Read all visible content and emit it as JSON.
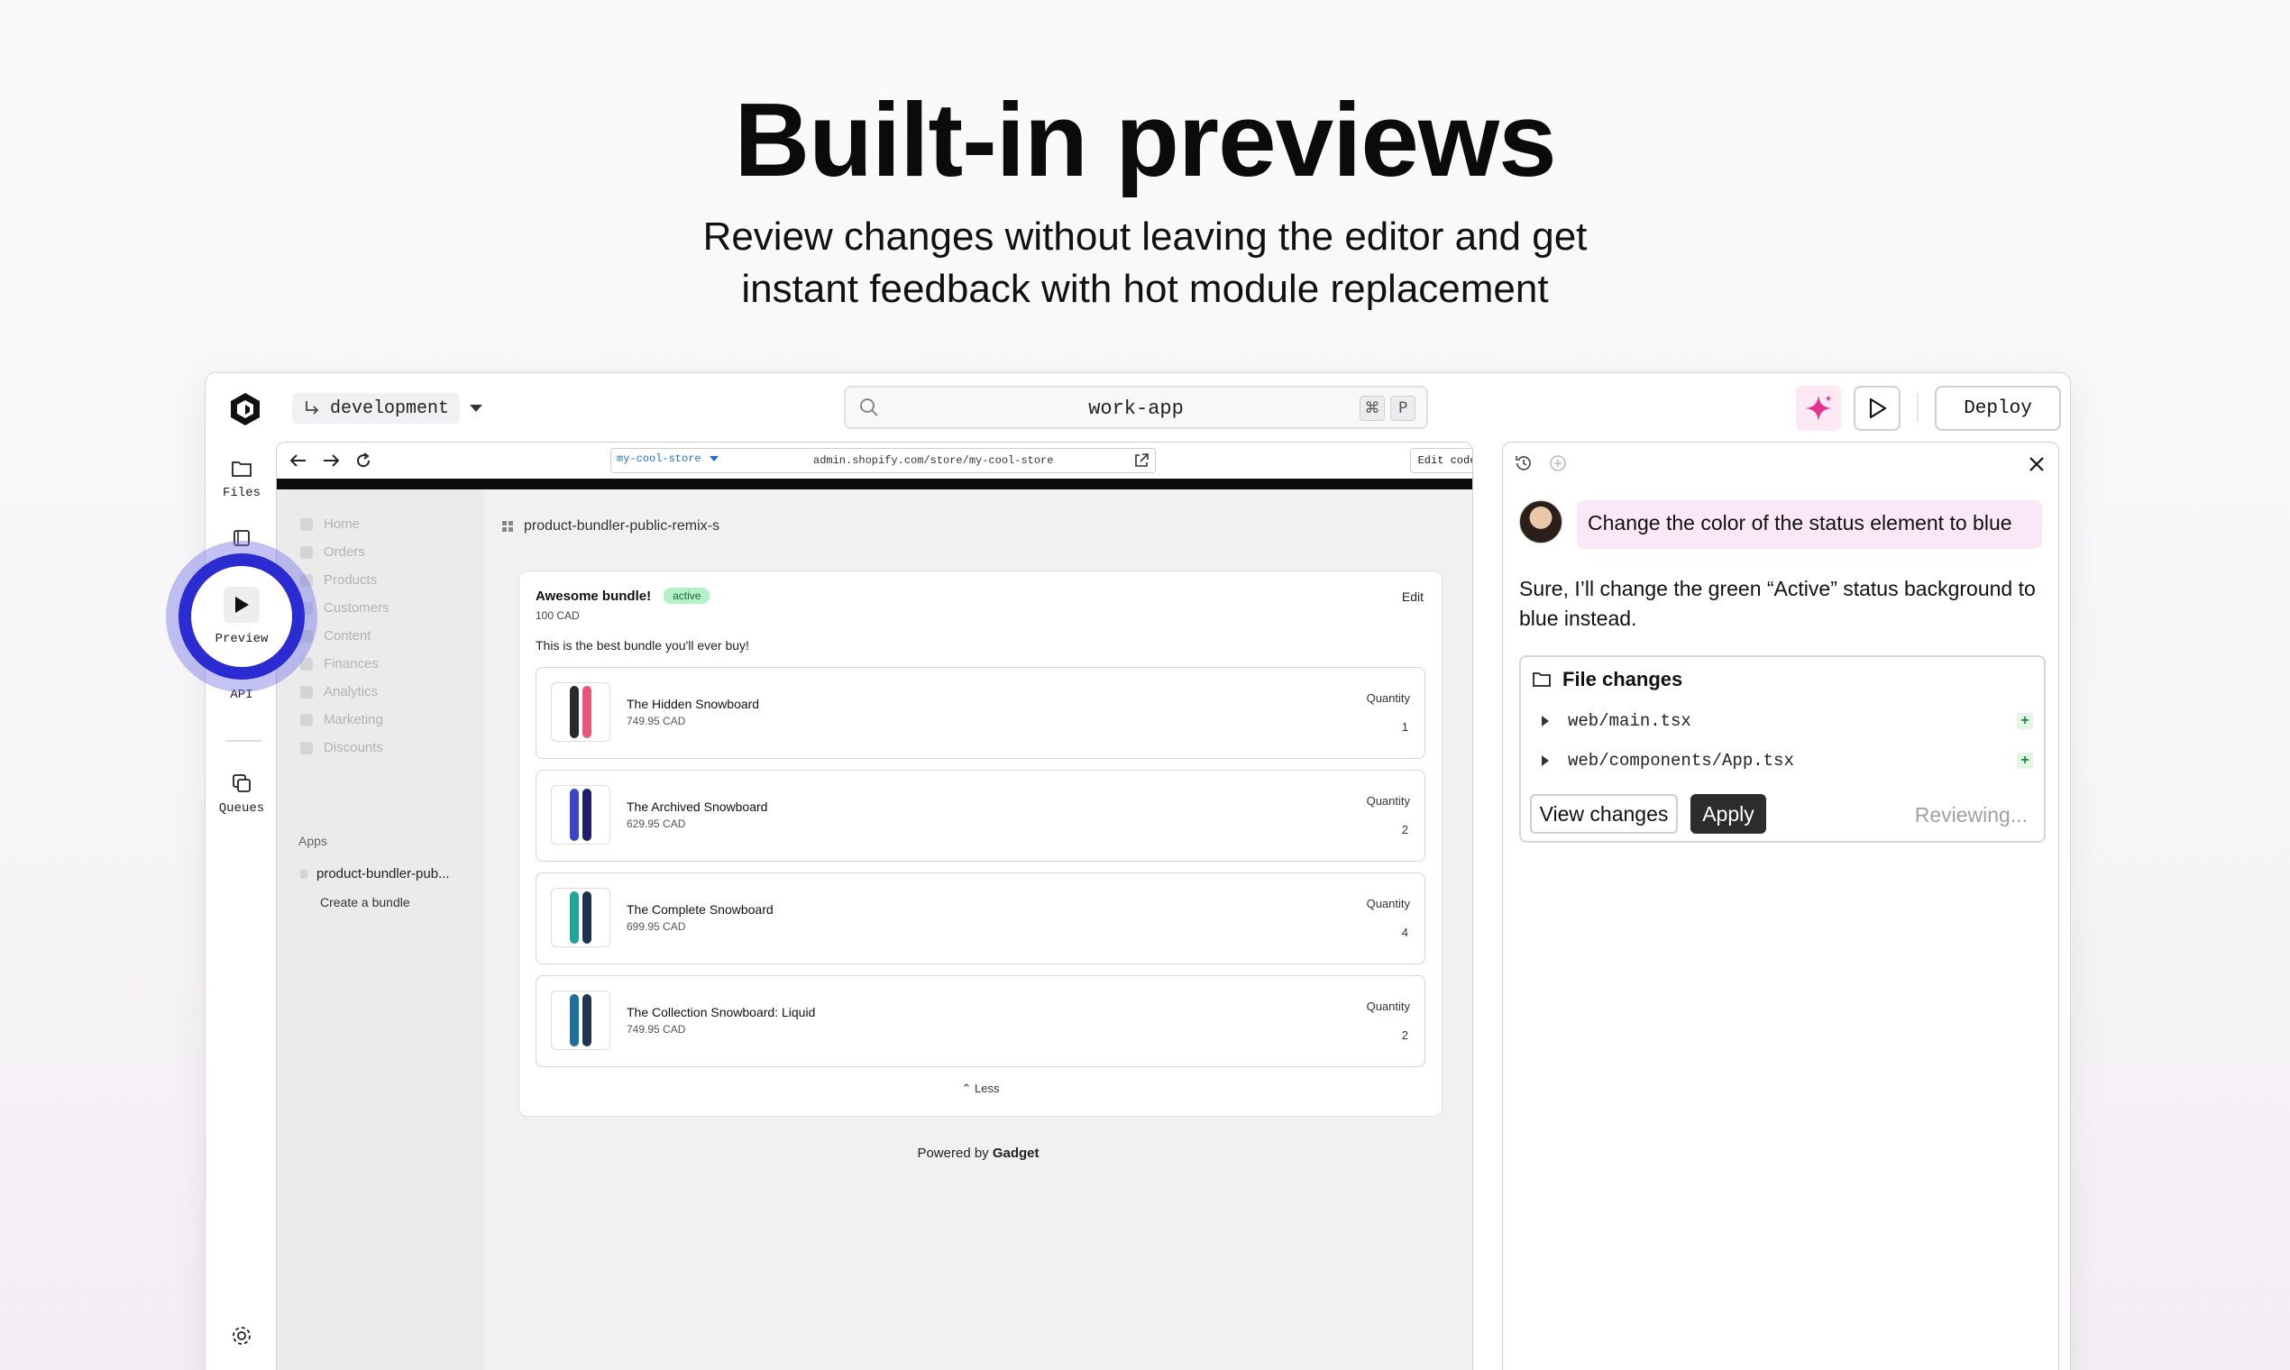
{
  "hero": {
    "title": "Built-in previews",
    "subtitle_line1": "Review changes without leaving the editor and get",
    "subtitle_line2": "instant feedback with hot module replacement"
  },
  "topbar": {
    "branch": "development",
    "search_text": "work-app",
    "shortcut_mod": "⌘",
    "shortcut_key": "P",
    "deploy_label": "Deploy"
  },
  "rail": {
    "files": "Files",
    "preview": "Preview",
    "api": "API",
    "queues": "Queues"
  },
  "browser": {
    "store": "my-cool-store",
    "url": "admin.shopify.com/store/my-cool-store",
    "edit_code": "Edit code"
  },
  "shop_nav": [
    "Home",
    "Orders",
    "Products",
    "Customers",
    "Content",
    "Finances",
    "Analytics",
    "Marketing",
    "Discounts"
  ],
  "apps": {
    "heading": "Apps",
    "item": "product-bundler-pub...",
    "sub": "Create a bundle"
  },
  "breadcrumb": "product-bundler-public-remix-s",
  "bundle": {
    "title": "Awesome bundle!",
    "status": "active",
    "price": "100 CAD",
    "edit": "Edit",
    "description": "This is the best bundle you'll ever buy!",
    "quantity_label": "Quantity",
    "less": "Less",
    "products": [
      {
        "name": "The Hidden Snowboard",
        "price": "749.95 CAD",
        "qty": "1",
        "colors": [
          "#2a2a2a",
          "#e8577a"
        ]
      },
      {
        "name": "The Archived Snowboard",
        "price": "629.95 CAD",
        "qty": "2",
        "colors": [
          "#3a45c9",
          "#1d1f6b"
        ]
      },
      {
        "name": "The Complete Snowboard",
        "price": "699.95 CAD",
        "qty": "4",
        "colors": [
          "#1fa59a",
          "#20304f"
        ]
      },
      {
        "name": "The Collection Snowboard: Liquid",
        "price": "749.95 CAD",
        "qty": "2",
        "colors": [
          "#1e6f9c",
          "#22344f"
        ]
      }
    ]
  },
  "powered": {
    "prefix": "Powered by",
    "brand": "Gadget"
  },
  "chat": {
    "user_message": "Change the color of the status element to blue",
    "reply": "Sure, I’ll change the green “Active” status background to blue instead.",
    "file_changes_title": "File changes",
    "files": [
      "web/main.tsx",
      "web/components/App.tsx"
    ],
    "view_changes": "View changes",
    "apply": "Apply",
    "status": "Reviewing..."
  },
  "colors": {
    "accent_ring": "#2a2bd0",
    "badge": "#b4f0c8",
    "user_bubble": "#fbe8f6"
  }
}
